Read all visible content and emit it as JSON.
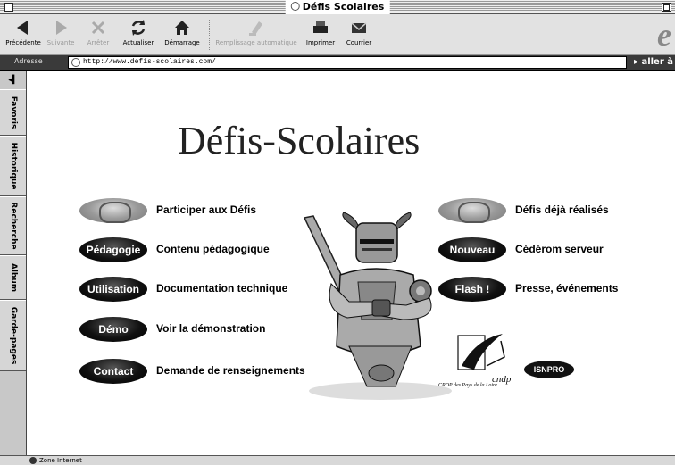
{
  "window": {
    "title": "Défis Scolaires"
  },
  "toolbar": {
    "buttons": [
      {
        "label": "Précédente",
        "icon": "back-arrow-icon",
        "enabled": true
      },
      {
        "label": "Suivante",
        "icon": "forward-arrow-icon",
        "enabled": false
      },
      {
        "label": "Arrêter",
        "icon": "stop-x-icon",
        "enabled": false
      },
      {
        "label": "Actualiser",
        "icon": "refresh-icon",
        "enabled": true
      },
      {
        "label": "Démarrage",
        "icon": "home-icon",
        "enabled": true
      },
      {
        "label": "Remplissage automatique",
        "icon": "autofill-icon",
        "enabled": false
      },
      {
        "label": "Imprimer",
        "icon": "printer-icon",
        "enabled": true
      },
      {
        "label": "Courrier",
        "icon": "mail-icon",
        "enabled": true
      }
    ],
    "browser_logo": "e"
  },
  "addressbar": {
    "label": "Adresse :",
    "url": "http://www.defis-scolaires.com/",
    "go_label": "aller à"
  },
  "sidebar": {
    "tabs": [
      "Favoris",
      "Historique",
      "Recherche",
      "Album",
      "Garde-pages"
    ]
  },
  "page": {
    "title": "Défis-Scolaires",
    "left_menu": [
      {
        "button": "",
        "label": "Participer aux Défis",
        "style": "grey"
      },
      {
        "button": "Pédagogie",
        "label": "Contenu pédagogique",
        "style": "black"
      },
      {
        "button": "Utilisation",
        "label": "Documentation technique",
        "style": "black"
      },
      {
        "button": "Démo",
        "label": "Voir la démonstration",
        "style": "black"
      },
      {
        "button": "Contact",
        "label": "Demande de renseignements",
        "style": "black"
      }
    ],
    "right_menu": [
      {
        "button": "",
        "label": "Défis déjà réalisés",
        "style": "grey"
      },
      {
        "button": "Nouveau",
        "label": "Cédérom serveur",
        "style": "black"
      },
      {
        "button": "Flash !",
        "label": "Presse, événements",
        "style": "black"
      }
    ],
    "partners": {
      "cndp_logo_text": "cndp",
      "cndp_caption": "CRDP des Pays de la Loire",
      "isnpro_logo_text": "ISNPRO"
    }
  },
  "statusbar": {
    "zone": "Zone Internet"
  }
}
